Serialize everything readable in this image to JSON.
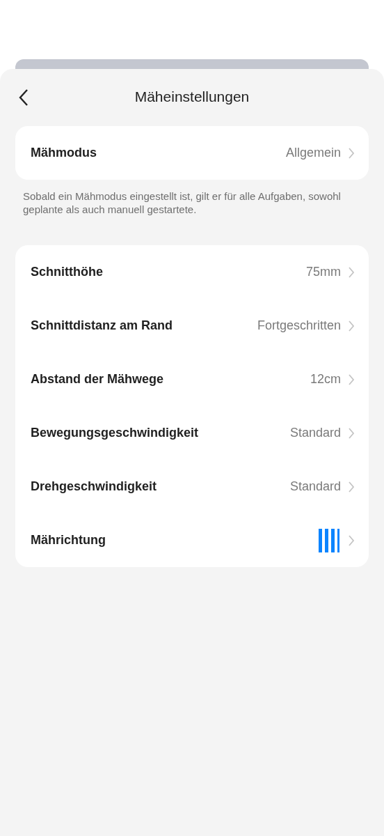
{
  "header": {
    "title": "Mäheinstellungen"
  },
  "mode_card": {
    "rows": [
      {
        "kind": "value",
        "label": "Mähmodus",
        "value": "Allgemein"
      }
    ]
  },
  "note": "Sobald ein Mähmodus eingestellt ist, gilt er für alle Aufgaben, sowohl geplante als auch manuell gestartete.",
  "settings_card": {
    "rows": [
      {
        "kind": "value",
        "label": "Schnitthöhe",
        "value": "75mm"
      },
      {
        "kind": "value",
        "label": "Schnittdistanz am Rand",
        "value": "Fortgeschritten"
      },
      {
        "kind": "value",
        "label": "Abstand der Mähwege",
        "value": "12cm"
      },
      {
        "kind": "value",
        "label": "Bewegungsgeschwindigkeit",
        "value": "Standard"
      },
      {
        "kind": "value",
        "label": "Drehgeschwindigkeit",
        "value": "Standard"
      },
      {
        "kind": "direction",
        "label": "Mährichtung"
      }
    ]
  }
}
